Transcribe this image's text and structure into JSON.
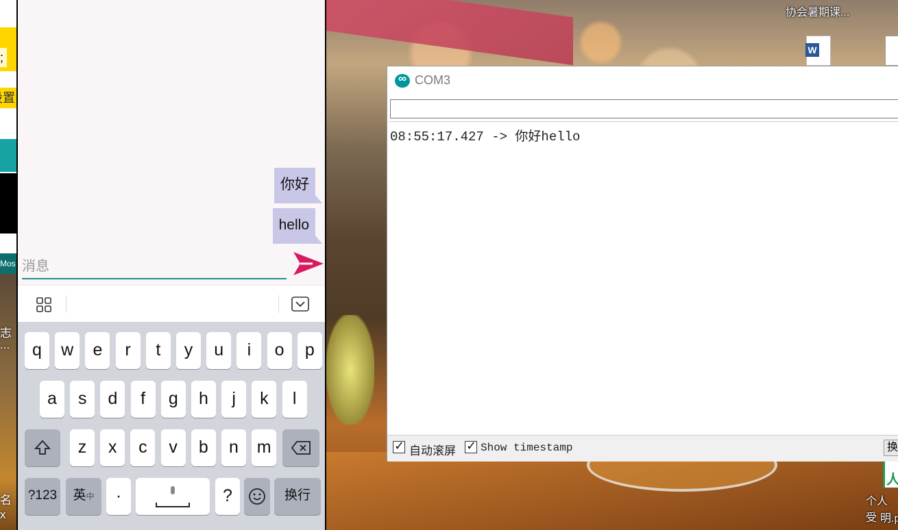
{
  "desktop": {
    "top_label": "协会暑期课...",
    "bottom_label_line1": "个人受",
    "bottom_label_line2": "明.p",
    "word_icon_letter": "W",
    "pdf_icon_letter": "人"
  },
  "left_window": {
    "semicolon": ";",
    "partial_text": "设置",
    "teal_text": "Mos",
    "side_text_1": "志",
    "side_text_2": "...",
    "side_text_3": "名",
    "side_text_4": "x"
  },
  "phone": {
    "messages": [
      "你好",
      "hello"
    ],
    "input": {
      "placeholder": "消息",
      "value": ""
    },
    "send_icon": "send-icon",
    "toolbar": {
      "grid_icon": "grid-icon",
      "hide_icon": "keyboard-hide-icon"
    },
    "keyboard": {
      "row1": [
        "q",
        "w",
        "e",
        "r",
        "t",
        "y",
        "u",
        "i",
        "o",
        "p"
      ],
      "row2": [
        "a",
        "s",
        "d",
        "f",
        "g",
        "h",
        "j",
        "k",
        "l"
      ],
      "row3": [
        "z",
        "x",
        "c",
        "v",
        "b",
        "n",
        "m"
      ],
      "shift_icon": "shift-icon",
      "backspace_icon": "backspace-icon",
      "num_key": "?123",
      "lang_key": "英",
      "lang_key_sub": "中",
      "dot_key": "·",
      "space_icon": "microphone-icon",
      "question_key": "?",
      "emoji_icon": "emoji-icon",
      "enter_key": "换行"
    }
  },
  "com_window": {
    "title": "COM3",
    "send_field_value": "",
    "output_line": "08:55:17.427 -> 你好hello",
    "autoscroll_label": "自动滚屏",
    "autoscroll_checked": true,
    "timestamp_label": "Show timestamp",
    "timestamp_checked": true,
    "line_ending_label": "换",
    "accent_color": "#00979c"
  }
}
